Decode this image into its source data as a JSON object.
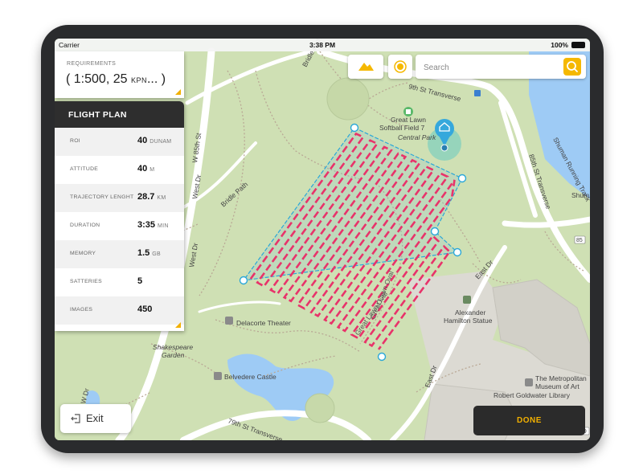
{
  "status_bar": {
    "carrier": "Carrier",
    "time": "3:38 PM",
    "battery": "100%"
  },
  "requirements": {
    "label": "REQUIREMENTS",
    "value_prefix": "( 1:500, 25 ",
    "value_unit": "KPN",
    "value_suffix": "... )"
  },
  "flight_plan": {
    "title": "FLIGHT PLAN",
    "rows": [
      {
        "label": "ROI",
        "value": "40",
        "unit": "DUNAM"
      },
      {
        "label": "ATTITUDE",
        "value": "40",
        "unit": "M"
      },
      {
        "label": "TRAJECTORY LENGHT",
        "value": "28.7",
        "unit": "KM"
      },
      {
        "label": "DURATION",
        "value": "3:35",
        "unit": "MIN"
      },
      {
        "label": "MEMORY",
        "value": "1.5",
        "unit": "GB"
      },
      {
        "label": "SATTERIES",
        "value": "5",
        "unit": ""
      },
      {
        "label": "IMAGES",
        "value": "450",
        "unit": ""
      }
    ]
  },
  "search": {
    "placeholder": "Search"
  },
  "buttons": {
    "exit": "Exit",
    "done": "DONE"
  },
  "map_labels": {
    "bridle_path_top": "Bridle Path",
    "w85": "W 85th St",
    "west_dr": "West Dr",
    "west_dr_2": "West Dr",
    "bridle_path": "Bridle Path",
    "great_lawn": "Great Lawn",
    "softball": "Softball Field 7",
    "central_park": "Central Park",
    "transverse_top": "9th St Transverse",
    "transverse_85": "85th St Transverse",
    "shuman": "Shuman Running Track",
    "shum": "Shum",
    "east_dr": "East Dr",
    "east_dr_2": "East Dr",
    "hamilton_1": "Alexander",
    "hamilton_2": "Hamilton Statue",
    "delacorte": "Delacorte Theater",
    "shakespeare_1": "Shakespeare",
    "shakespeare_2": "Garden",
    "belvedere": "Belvedere Castle",
    "met_1": "The Metropolitan",
    "met_2": "Museum of Art",
    "goldwater": "Robert Goldwater Library",
    "transverse_79": "79th St Transverse",
    "oval_1": "Great Lawn Oval",
    "oval_2": "Great Lawn Oval",
    "w_dr": "W Dr",
    "sign_85": "85",
    "sign_79": "79"
  },
  "colors": {
    "accent": "#f5b800",
    "route": "#e8336a",
    "boundary": "#2aa7d8",
    "water": "#9ecbf5",
    "park": "#cfe0b4",
    "dark_panel": "#2e2e2e"
  }
}
